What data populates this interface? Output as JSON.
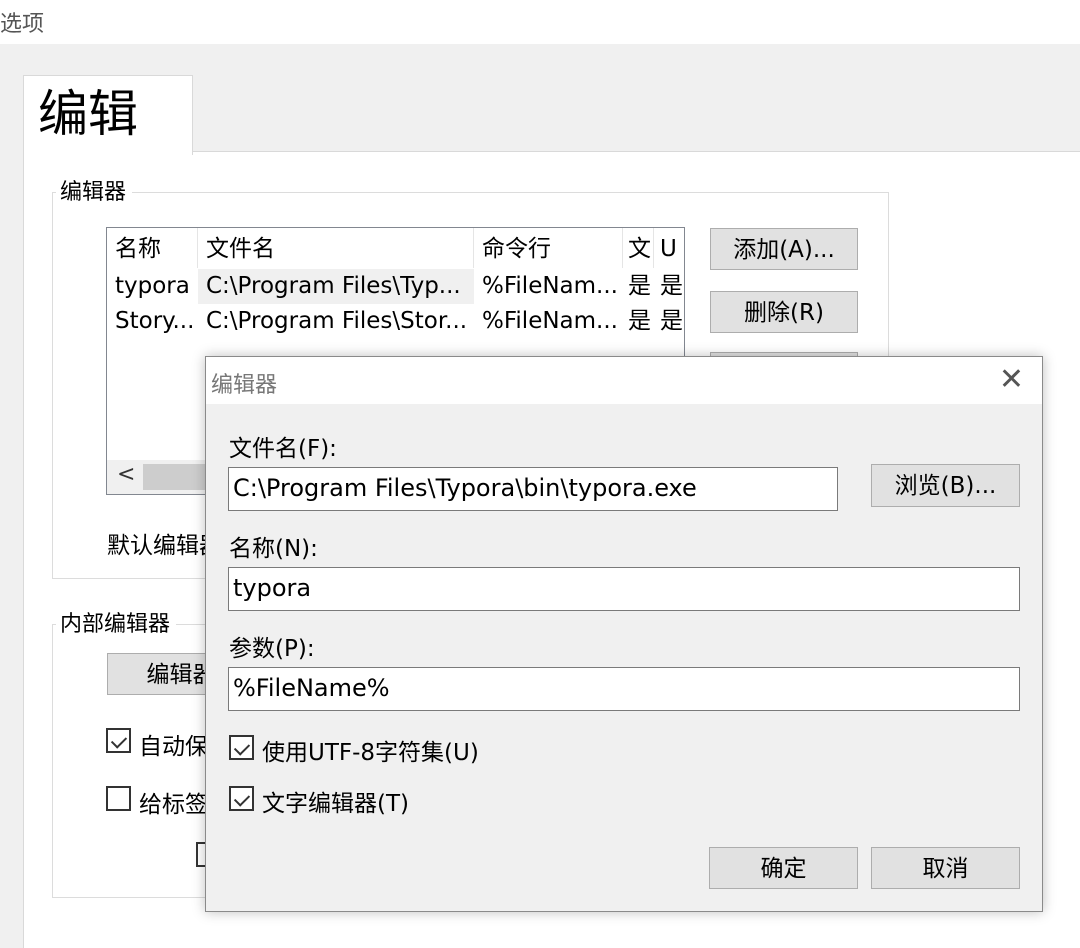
{
  "window": {
    "title": "选项"
  },
  "tab": {
    "label": "编辑"
  },
  "editors_group": {
    "label": "编辑器",
    "columns": [
      "名称",
      "文件名",
      "命令行",
      "文",
      "U"
    ],
    "rows": [
      {
        "name": "typora",
        "file": "C:\\Program Files\\Typ...",
        "cmd": "%FileNam...",
        "text": "是",
        "utf": "是"
      },
      {
        "name": "Story...",
        "file": "C:\\Program Files\\Stor...",
        "cmd": "%FileNam...",
        "text": "是",
        "utf": "是"
      }
    ],
    "scroll_left": "<",
    "add_button": "添加(A)...",
    "delete_button": "删除(R)",
    "default_label": "默认编辑器"
  },
  "internal_group": {
    "label": "内部编辑器",
    "editor_button": "编辑器",
    "auto_save_label": "自动保",
    "auto_save_checked": true,
    "tag_label": "给标签",
    "tag_checked": false
  },
  "dialog": {
    "title": "编辑器",
    "close_glyph": "✕",
    "filename_label": "文件名(F):",
    "filename_value": "C:\\Program Files\\Typora\\bin\\typora.exe",
    "browse_button": "浏览(B)...",
    "name_label": "名称(N):",
    "name_value": "typora",
    "params_label": "参数(P):",
    "params_value": "%FileName%",
    "utf8_label": "使用UTF-8字符集(U)",
    "utf8_checked": true,
    "text_editor_label": "文字编辑器(T)",
    "text_editor_checked": true,
    "ok_button": "确定",
    "cancel_button": "取消"
  }
}
